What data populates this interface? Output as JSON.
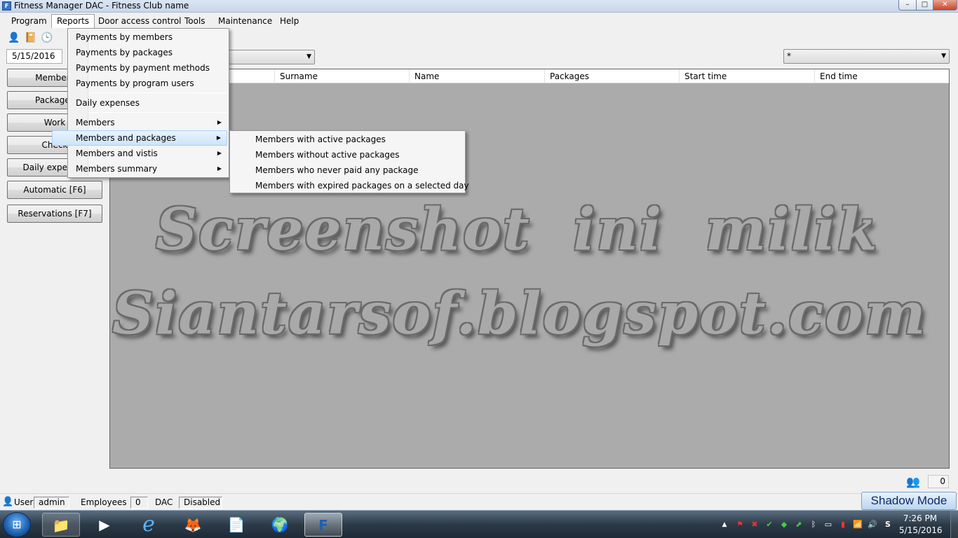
{
  "window": {
    "title": "Fitness Manager DAC - Fitness Club name",
    "app_icon_glyph": "F",
    "min_glyph": "–",
    "max_glyph": "□",
    "close_glyph": "✕"
  },
  "menubar": {
    "items": [
      "Program",
      "Reports",
      "Door access control",
      "Tools",
      "Maintenance",
      "Help"
    ]
  },
  "toolbar": {
    "icons": [
      {
        "name": "user-icon",
        "glyph": "👤"
      },
      {
        "name": "notebook-icon",
        "glyph": "📔"
      },
      {
        "name": "clock-icon",
        "glyph": "🕒"
      }
    ]
  },
  "filters": {
    "date": "5/15/2016",
    "right_combo_value": "*",
    "arrow_glyph": "▼"
  },
  "side_buttons": [
    "Members",
    "Packages",
    "Work",
    "Check",
    "Daily expenses",
    "Automatic [F6]",
    "Reservations [F7]"
  ],
  "grid": {
    "columns": [
      "",
      "Surname",
      "Name",
      "Packages",
      "Start time",
      "End time"
    ]
  },
  "watermark": {
    "line1": "Screenshot ini milik",
    "line2": "Siantarsof.blogspot.com"
  },
  "reports_menu": {
    "items": [
      {
        "label": "Payments by members",
        "submenu": false
      },
      {
        "label": "Payments by packages",
        "submenu": false
      },
      {
        "label": "Payments by payment methods",
        "submenu": false
      },
      {
        "label": "Payments by program users",
        "submenu": false
      },
      {
        "label": "Daily expenses",
        "submenu": false
      },
      {
        "label": "Members",
        "submenu": true
      },
      {
        "label": "Members and packages",
        "submenu": true,
        "highlighted": true
      },
      {
        "label": "Members and vistis",
        "submenu": true
      },
      {
        "label": "Members summary",
        "submenu": true
      }
    ],
    "submenu_arrow": "▶"
  },
  "members_packages_submenu": {
    "items": [
      "Members with active packages",
      "Members without active packages",
      "Members who never paid any package",
      "Members with expired packages on a selected day"
    ]
  },
  "bottom": {
    "users_icon_glyph": "👥",
    "counter": "0"
  },
  "statusbar": {
    "user_icon_glyph": "👤",
    "user_label": "User",
    "user_value": "admin",
    "employees_label": "Employees",
    "employees_value": "0",
    "dac_label": "DAC",
    "dac_value": "Disabled",
    "shadow_mode": "Shadow Mode"
  },
  "taskbar": {
    "start_glyph": "⊞",
    "apps": [
      {
        "name": "explorer-app",
        "glyph": "📁"
      },
      {
        "name": "media-player-app",
        "glyph": "▶"
      },
      {
        "name": "internet-explorer-app",
        "glyph": "e"
      },
      {
        "name": "firefox-app",
        "glyph": "🦊"
      },
      {
        "name": "notepad-app",
        "glyph": "📄"
      },
      {
        "name": "globe-app",
        "glyph": "🌍"
      },
      {
        "name": "fitness-manager-app",
        "glyph": "F"
      }
    ],
    "tray": [
      {
        "name": "tray-show-hidden-icon",
        "glyph": "▲"
      },
      {
        "name": "tray-flag-icon",
        "glyph": "⚑"
      },
      {
        "name": "tray-error-icon",
        "glyph": "✖"
      },
      {
        "name": "tray-check-icon",
        "glyph": "✔"
      },
      {
        "name": "tray-network-app-icon",
        "glyph": "◆"
      },
      {
        "name": "tray-update-icon",
        "glyph": "⬈"
      },
      {
        "name": "tray-bluetooth-icon",
        "glyph": "ᛒ"
      },
      {
        "name": "tray-display-icon",
        "glyph": "▭"
      },
      {
        "name": "tray-battery-icon",
        "glyph": "▮"
      },
      {
        "name": "tray-signal-icon",
        "glyph": "📶"
      },
      {
        "name": "tray-volume-icon",
        "glyph": "🔊"
      },
      {
        "name": "tray-skype-icon",
        "glyph": "S"
      }
    ],
    "time": "7:26 PM",
    "date": "5/15/2016"
  }
}
